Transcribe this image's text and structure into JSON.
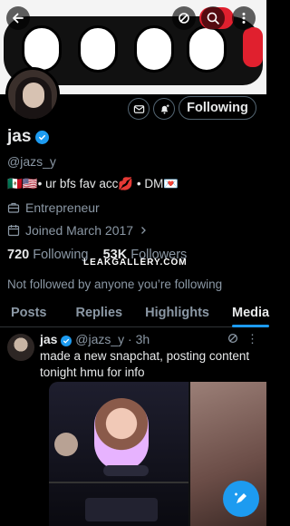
{
  "profile": {
    "name": "jas",
    "handle": "@jazs_y",
    "bio": "🇲🇽🇺🇸• ur bfs fav acc💋 • DM💌",
    "profession": "Entrepreneur",
    "joined": "Joined March 2017",
    "following_count": "720",
    "following_label": "Following",
    "followers_count": "53K",
    "followers_label": "Followers",
    "follow_button_label": "Following",
    "not_followed_text": "Not followed by anyone you’re following"
  },
  "watermark": "LEAKGALLERY.COM",
  "tabs": [
    {
      "label": "Posts"
    },
    {
      "label": "Replies"
    },
    {
      "label": "Highlights"
    },
    {
      "label": "Media",
      "active": true
    }
  ],
  "post": {
    "author_name": "jas",
    "author_handle": "@jazs_y",
    "time": "· 3h",
    "text": "made a new snapchat, posting content tonight hmu for info"
  },
  "colors": {
    "accent": "#1d9bf0",
    "background": "#000000",
    "secondary_text": "#8b98a5"
  },
  "icons": [
    "back-arrow-icon",
    "grok-icon",
    "search-icon",
    "more-vertical-icon",
    "message-icon",
    "bell-plus-icon",
    "verified-icon",
    "briefcase-icon",
    "calendar-icon",
    "chevron-right-icon",
    "compose-icon"
  ]
}
